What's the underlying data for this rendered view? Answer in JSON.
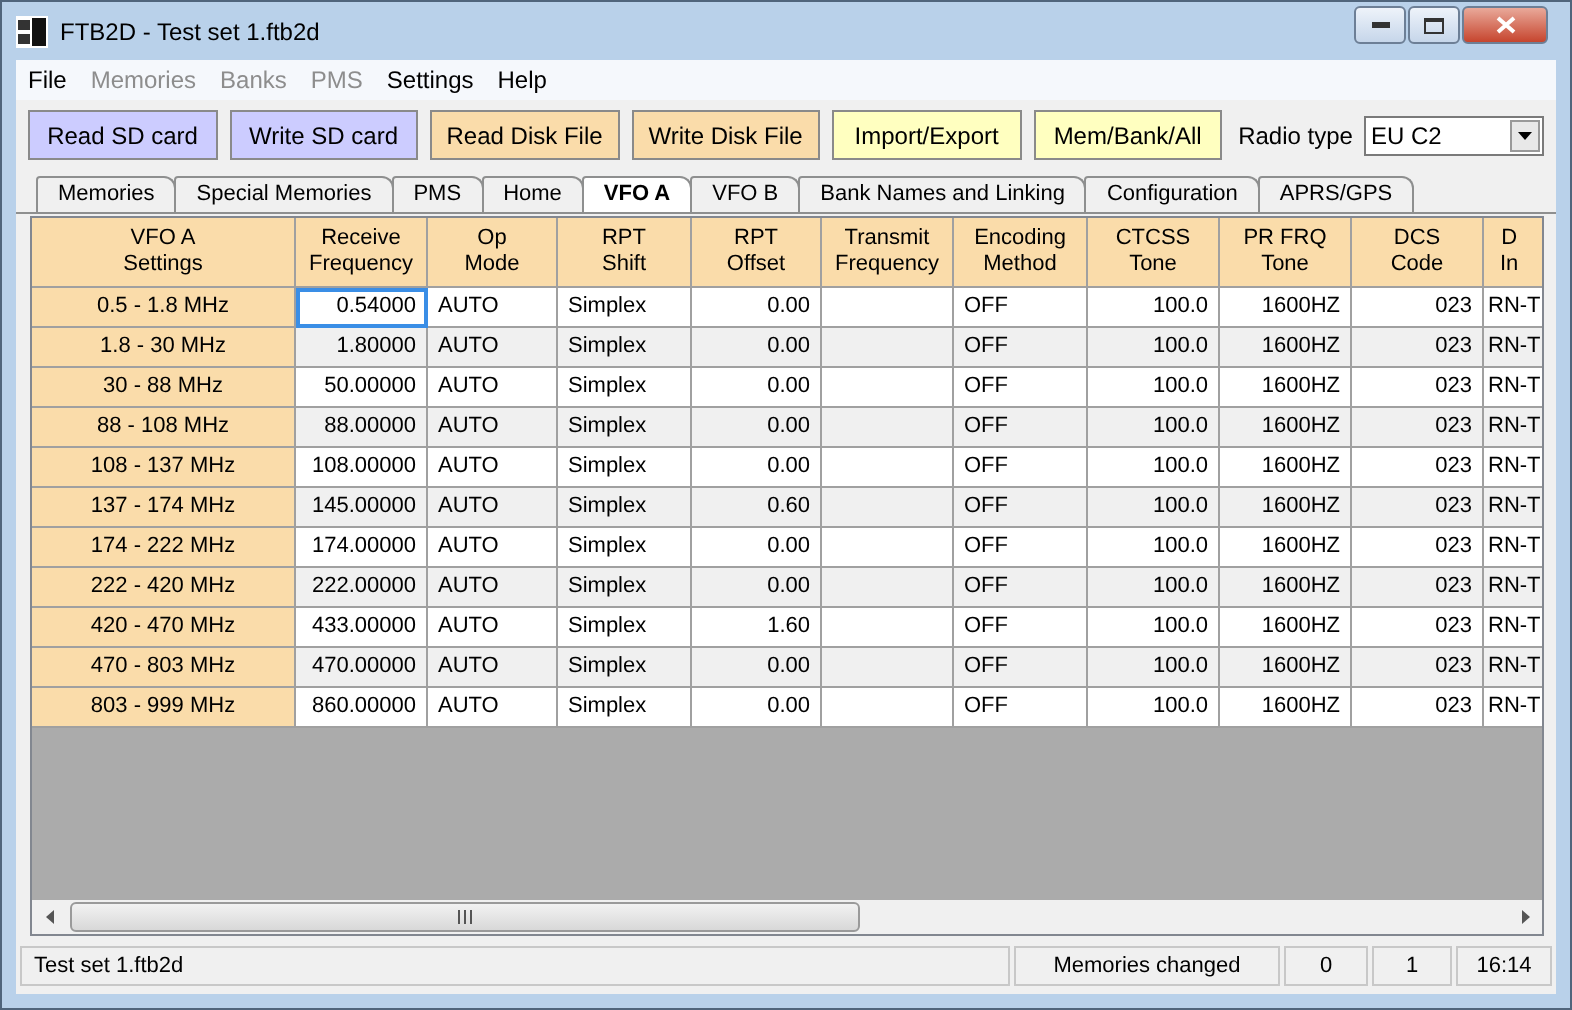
{
  "window": {
    "title": "FTB2D - Test set 1.ftb2d"
  },
  "menu": [
    {
      "label": "File",
      "disabled": false
    },
    {
      "label": "Memories",
      "disabled": true
    },
    {
      "label": "Banks",
      "disabled": true
    },
    {
      "label": "PMS",
      "disabled": true
    },
    {
      "label": "Settings",
      "disabled": false
    },
    {
      "label": "Help",
      "disabled": false
    }
  ],
  "toolbar": {
    "buttons": [
      {
        "label": "Read SD card",
        "color": "#ccccff"
      },
      {
        "label": "Write SD card",
        "color": "#ccccff"
      },
      {
        "label": "Read Disk File",
        "color": "#fadcaa"
      },
      {
        "label": "Write Disk File",
        "color": "#fadcaa"
      },
      {
        "label": "Import/Export",
        "color": "#ffffc0"
      },
      {
        "label": "Mem/Bank/All",
        "color": "#ffffc0"
      }
    ],
    "radio_type": {
      "label": "Radio type",
      "value": "EU C2"
    }
  },
  "tabs": [
    {
      "label": "Memories",
      "selected": false
    },
    {
      "label": "Special Memories",
      "selected": false
    },
    {
      "label": "PMS",
      "selected": false
    },
    {
      "label": "Home",
      "selected": false
    },
    {
      "label": "VFO A",
      "selected": true
    },
    {
      "label": "VFO B",
      "selected": false
    },
    {
      "label": "Bank Names and Linking",
      "selected": false
    },
    {
      "label": "Configuration",
      "selected": false
    },
    {
      "label": "APRS/GPS",
      "selected": false
    }
  ],
  "table": {
    "columns": [
      "VFO A\nSettings",
      "Receive\nFrequency",
      "Op\nMode",
      "RPT\nShift",
      "RPT\nOffset",
      "Transmit\nFrequency",
      "Encoding\nMethod",
      "CTCSS\nTone",
      "PR FRQ\nTone",
      "DCS\nCode",
      "D\nIn"
    ],
    "rows": [
      {
        "focused": true,
        "cells": [
          "0.5 - 1.8 MHz",
          "0.54000",
          "AUTO",
          "Simplex",
          "0.00",
          "",
          "OFF",
          "100.0",
          "1600HZ",
          "023",
          "RN-T"
        ]
      },
      {
        "focused": false,
        "cells": [
          "1.8 - 30 MHz",
          "1.80000",
          "AUTO",
          "Simplex",
          "0.00",
          "",
          "OFF",
          "100.0",
          "1600HZ",
          "023",
          "RN-T"
        ]
      },
      {
        "focused": false,
        "cells": [
          "30 - 88 MHz",
          "50.00000",
          "AUTO",
          "Simplex",
          "0.00",
          "",
          "OFF",
          "100.0",
          "1600HZ",
          "023",
          "RN-T"
        ]
      },
      {
        "focused": false,
        "cells": [
          "88 - 108 MHz",
          "88.00000",
          "AUTO",
          "Simplex",
          "0.00",
          "",
          "OFF",
          "100.0",
          "1600HZ",
          "023",
          "RN-T"
        ]
      },
      {
        "focused": false,
        "cells": [
          "108 - 137 MHz",
          "108.00000",
          "AUTO",
          "Simplex",
          "0.00",
          "",
          "OFF",
          "100.0",
          "1600HZ",
          "023",
          "RN-T"
        ]
      },
      {
        "focused": false,
        "cells": [
          "137 - 174 MHz",
          "145.00000",
          "AUTO",
          "Simplex",
          "0.60",
          "",
          "OFF",
          "100.0",
          "1600HZ",
          "023",
          "RN-T"
        ]
      },
      {
        "focused": false,
        "cells": [
          "174 - 222 MHz",
          "174.00000",
          "AUTO",
          "Simplex",
          "0.00",
          "",
          "OFF",
          "100.0",
          "1600HZ",
          "023",
          "RN-T"
        ]
      },
      {
        "focused": false,
        "cells": [
          "222 - 420 MHz",
          "222.00000",
          "AUTO",
          "Simplex",
          "0.00",
          "",
          "OFF",
          "100.0",
          "1600HZ",
          "023",
          "RN-T"
        ]
      },
      {
        "focused": false,
        "cells": [
          "420 - 470 MHz",
          "433.00000",
          "AUTO",
          "Simplex",
          "1.60",
          "",
          "OFF",
          "100.0",
          "1600HZ",
          "023",
          "RN-T"
        ]
      },
      {
        "focused": false,
        "cells": [
          "470 - 803 MHz",
          "470.00000",
          "AUTO",
          "Simplex",
          "0.00",
          "",
          "OFF",
          "100.0",
          "1600HZ",
          "023",
          "RN-T"
        ]
      },
      {
        "focused": false,
        "cells": [
          "803 - 999 MHz",
          "860.00000",
          "AUTO",
          "Simplex",
          "0.00",
          "",
          "OFF",
          "100.0",
          "1600HZ",
          "023",
          "RN-T"
        ]
      }
    ]
  },
  "status_bar": [
    "Test set 1.ftb2d",
    "Memories changed",
    "0",
    "1",
    "16:14"
  ]
}
